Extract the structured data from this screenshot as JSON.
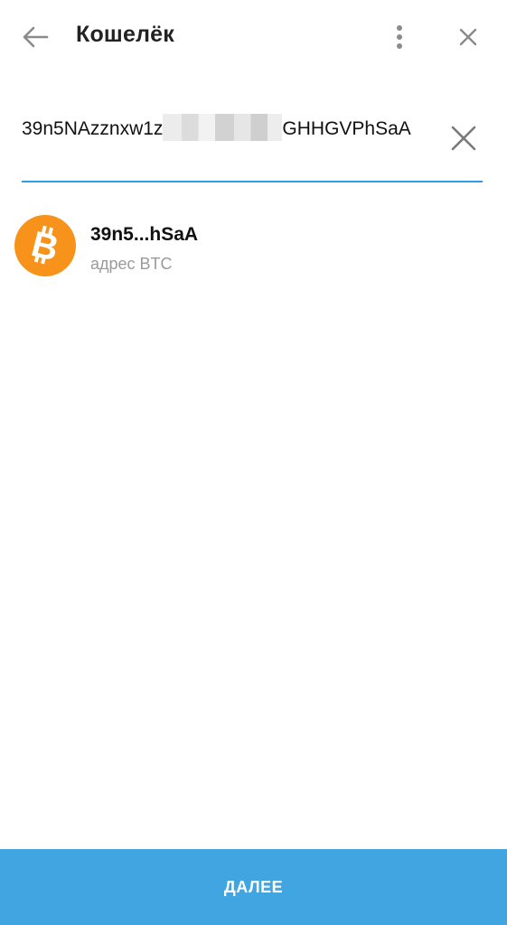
{
  "header": {
    "title": "Кошелёк",
    "back_icon": "arrow-left-icon",
    "menu_icon": "more-vertical-icon",
    "close_icon": "close-icon"
  },
  "address_input": {
    "value_start": "39n5NAzznxw1z",
    "value_end": "GHHGVPhSaA",
    "clear_icon": "clear-icon"
  },
  "result": {
    "title": "39n5...hSaA",
    "subtitle": "адрес BTC",
    "icon": "bitcoin-icon",
    "icon_color": "#f7931a"
  },
  "footer": {
    "next_label": "ДАЛЕЕ",
    "button_color": "#41a5e1"
  },
  "colors": {
    "accent": "#2f9be0"
  }
}
